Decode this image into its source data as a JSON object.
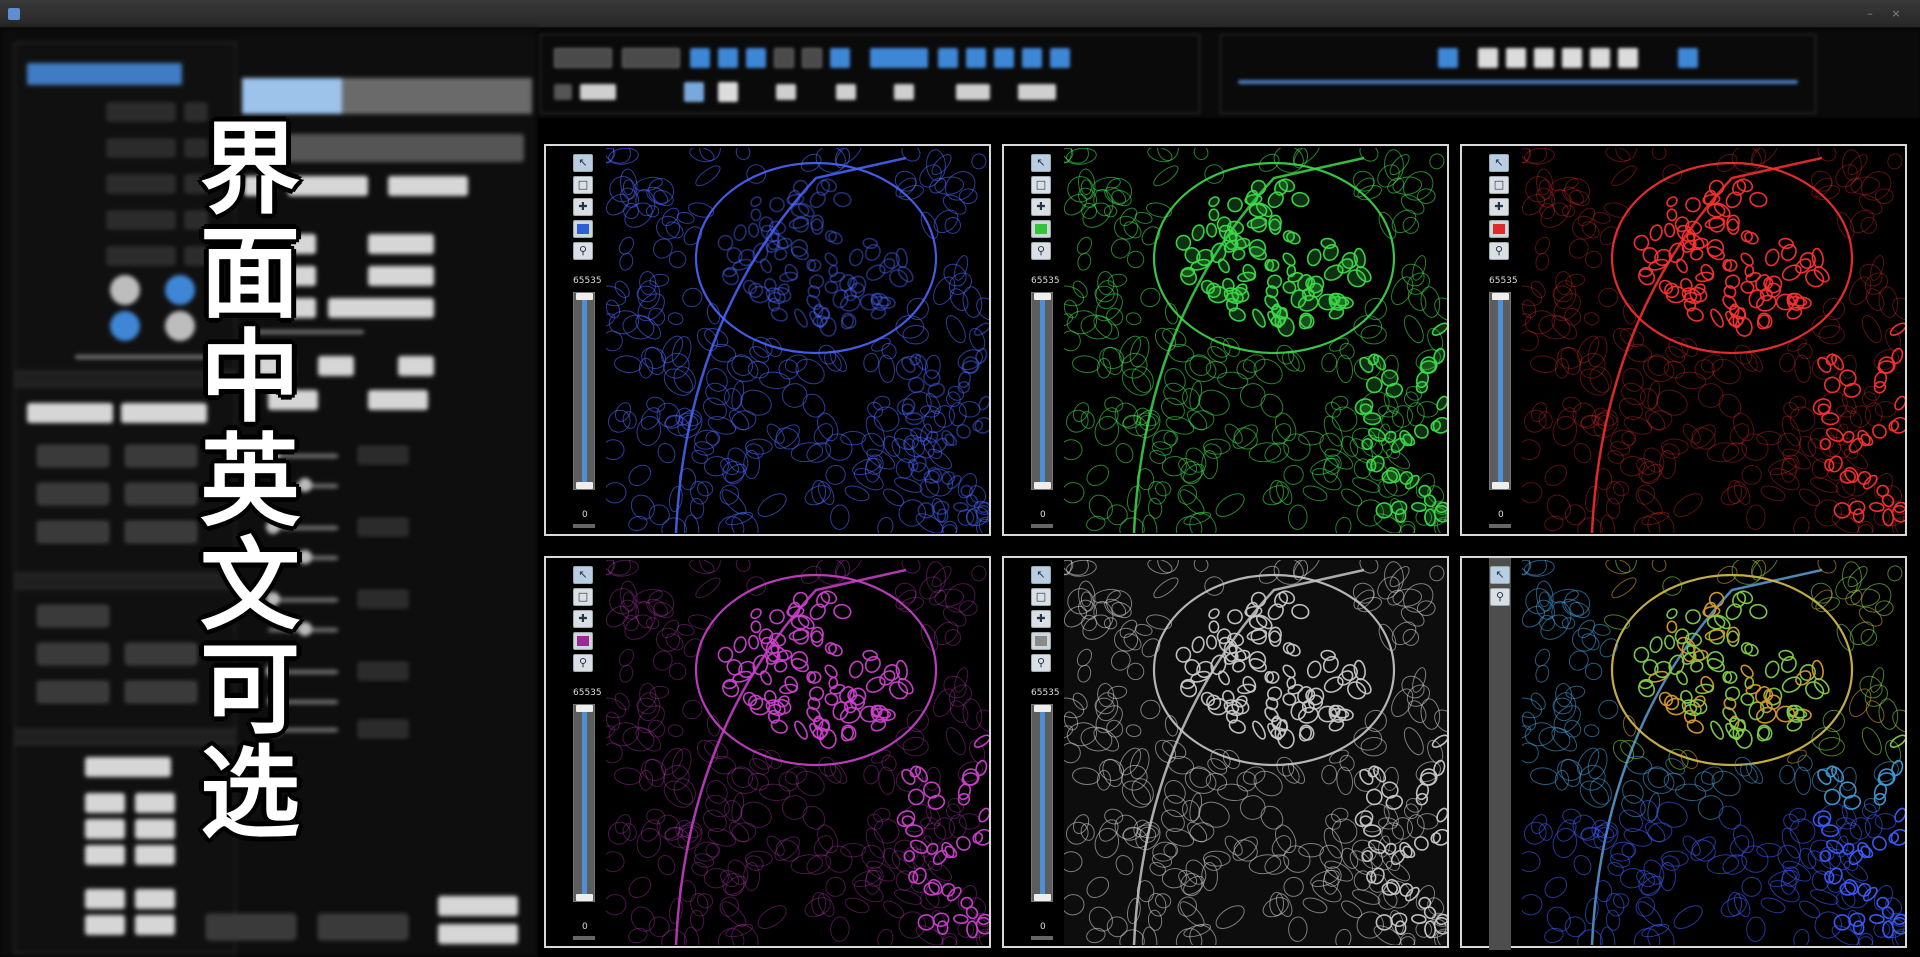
{
  "window": {
    "title": ""
  },
  "overlay": {
    "chars": [
      "界",
      "面",
      "中",
      "英",
      "文",
      "可",
      "选"
    ]
  },
  "viewers": [
    {
      "id": "blue",
      "channel_color": "#2c5fd6",
      "tint": "#4a66ff",
      "max_label": "65535",
      "min_label": "0",
      "show_swatch": true
    },
    {
      "id": "green",
      "channel_color": "#35c23d",
      "tint": "#3ddc4a",
      "max_label": "65535",
      "min_label": "0",
      "show_swatch": true
    },
    {
      "id": "red",
      "channel_color": "#e02a2a",
      "tint": "#ff3030",
      "max_label": "65535",
      "min_label": "0",
      "show_swatch": true
    },
    {
      "id": "magenta",
      "channel_color": "#9a2a9a",
      "tint": "#d040d0",
      "max_label": "65535",
      "min_label": "0",
      "show_swatch": true
    },
    {
      "id": "gray",
      "channel_color": "#8a8a8a",
      "tint": "#c8c8c8",
      "max_label": "65535",
      "min_label": "0",
      "show_swatch": true
    },
    {
      "id": "merge",
      "channel_color": "",
      "tint": "merge",
      "max_label": "",
      "min_label": "",
      "show_swatch": false
    }
  ],
  "icons": {
    "pointer": "pointer-icon",
    "rect": "rectangle-select-icon",
    "pan": "pan-move-icon",
    "zoom": "zoom-magnifier-icon"
  }
}
